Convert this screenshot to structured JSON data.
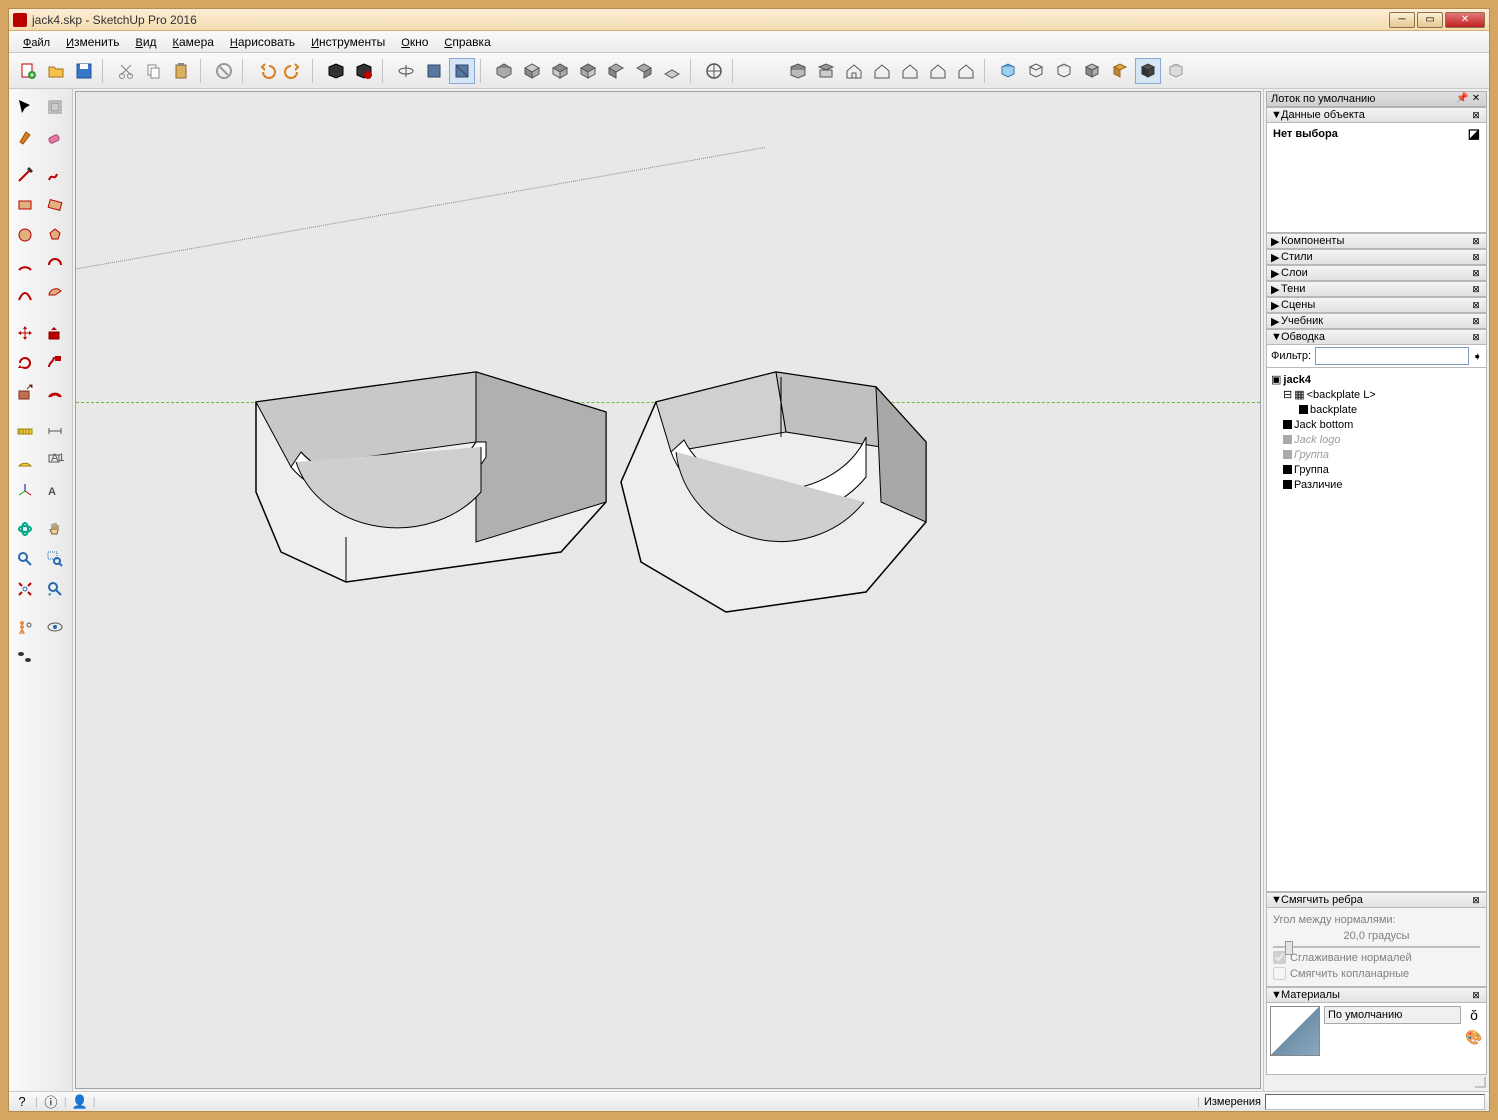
{
  "window": {
    "title": "jack4.skp - SketchUp Pro 2016",
    "min": "−",
    "max": "▢",
    "close": "X"
  },
  "menu": {
    "file": "Файл",
    "edit": "Изменить",
    "view": "Вид",
    "camera": "Камера",
    "draw": "Нарисовать",
    "tools": "Инструменты",
    "window": "Окно",
    "help": "Справка"
  },
  "tray": {
    "title": "Лоток по умолчанию"
  },
  "panels": {
    "entity": {
      "title": "Данные объекта",
      "empty": "Нет выбора"
    },
    "components": "Компоненты",
    "styles": "Стили",
    "layers": "Слои",
    "shadows": "Тени",
    "scenes": "Сцены",
    "instructor": "Учебник",
    "outliner": {
      "title": "Обводка",
      "filter": "Фильтр:"
    },
    "soften": {
      "title": "Смягчить ребра",
      "angle_label": "Угол между нормалями:",
      "angle_val": "20,0  градусы",
      "smooth_normals": "Сглаживание нормалей",
      "soft_coplanar": "Смягчить копланарные"
    },
    "materials": {
      "title": "Материалы",
      "default": "По умолчанию"
    }
  },
  "tree": {
    "root": "jack4",
    "items": [
      {
        "label": "<backplate L>",
        "indent": 1,
        "component": true
      },
      {
        "label": "backplate",
        "indent": 2
      },
      {
        "label": "Jack bottom",
        "indent": 1
      },
      {
        "label": "Jack logo",
        "indent": 1,
        "faded": true
      },
      {
        "label": "Группа",
        "indent": 1,
        "faded": true
      },
      {
        "label": "Группа",
        "indent": 1
      },
      {
        "label": "Различие",
        "indent": 1
      }
    ]
  },
  "status": {
    "measure_label": "Измерения",
    "measure_value": ""
  },
  "top_icons": [
    "new-icon",
    "open-icon",
    "save-icon",
    "cut-icon",
    "copy-icon",
    "paste-icon",
    "erase-icon",
    "undo-icon",
    "redo-icon",
    "print-icon",
    "model-icon",
    "orbit-icon",
    "pan-icon",
    "zoom-icon",
    "iso-icon",
    "top-icon",
    "front-icon",
    "right-icon",
    "back-icon",
    "left-icon",
    "extents-icon",
    "shade1-icon",
    "shade2-icon",
    "shade3-icon",
    "shade4-icon",
    "shade5-icon",
    "shade6-icon",
    "xray-icon",
    "bg-icon",
    "fog-icon",
    "s1-icon",
    "s2-icon",
    "s3-icon",
    "s4-icon",
    "s5-icon"
  ],
  "colors": {
    "accent": "#b00"
  }
}
